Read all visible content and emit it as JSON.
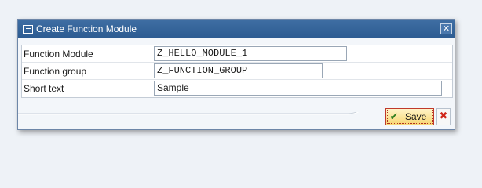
{
  "dialog": {
    "title": "Create Function Module",
    "title_icon": "create-document-icon",
    "close_glyph": "✕"
  },
  "form": {
    "fields": [
      {
        "label": "Function Module",
        "value": "Z_HELLO_MODULE_1"
      },
      {
        "label": "Function group",
        "value": "Z_FUNCTION_GROUP"
      },
      {
        "label": "Short text",
        "value": "Sample"
      }
    ]
  },
  "buttons": {
    "save_label": "Save",
    "save_icon": "checkmark-icon",
    "save_glyph": "✔",
    "cancel_icon": "cancel-x-icon",
    "cancel_glyph": "✖"
  },
  "colors": {
    "titlebar": "#2c5b91",
    "save_bg": "#f7d774",
    "cancel_red": "#d0261a",
    "check_green": "#2f7d1f"
  }
}
